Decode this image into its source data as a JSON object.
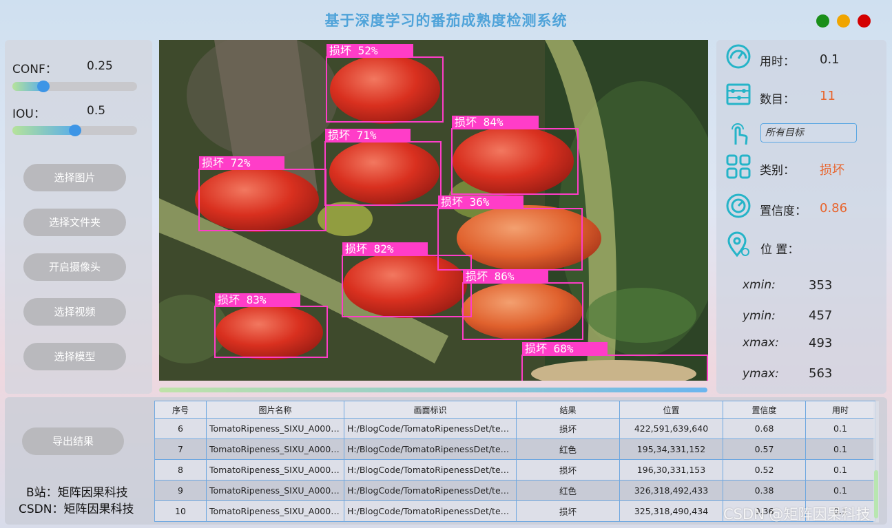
{
  "app": {
    "title": "基于深度学习的番茄成熟度检测系统"
  },
  "window_controls": [
    {
      "name": "maximize",
      "color": "#1a8f1a"
    },
    {
      "name": "minimize",
      "color": "#f0a500"
    },
    {
      "name": "close",
      "color": "#d40000"
    }
  ],
  "settings": {
    "conf": {
      "label": "CONF：",
      "value": "0.25",
      "fraction": 0.25
    },
    "iou": {
      "label": "IOU：",
      "value": "0.5",
      "fraction": 0.5
    }
  },
  "buttons": {
    "select_image": "选择图片",
    "select_folder": "选择文件夹",
    "open_camera": "开启摄像头",
    "select_video": "选择视频",
    "select_model": "选择模型",
    "export": "导出结果"
  },
  "detections": [
    {
      "label": "损坏 52%"
    },
    {
      "label": "损坏 71%"
    },
    {
      "label": "损坏 84%"
    },
    {
      "label": "损坏 72%"
    },
    {
      "label": "损坏 36%"
    },
    {
      "label": "损坏 82%"
    },
    {
      "label": "损坏 86%"
    },
    {
      "label": "损坏 83%"
    },
    {
      "label": "损坏 68%"
    }
  ],
  "info": {
    "time": {
      "label": "用时：",
      "value": "0.1"
    },
    "count": {
      "label": "数目：",
      "value": "11"
    },
    "target_select": "所有目标",
    "category": {
      "label": "类别：",
      "value": "损坏"
    },
    "confidence": {
      "label": "置信度：",
      "value": "0.86"
    },
    "position": {
      "label": "位 置："
    },
    "xmin": {
      "label": "xmin:",
      "value": "353"
    },
    "ymin": {
      "label": "ymin:",
      "value": "457"
    },
    "xmax": {
      "label": "xmax:",
      "value": "493"
    },
    "ymax": {
      "label": "ymax:",
      "value": "563"
    },
    "accent_color": "#e8642c"
  },
  "table": {
    "headers": [
      "序号",
      "图片名称",
      "画面标识",
      "结果",
      "位置",
      "置信度",
      "用时"
    ],
    "rows": [
      [
        "6",
        "TomatoRipeness_SIXU_A0001...",
        "H:/BlogCode/TomatoRipenessDet/tes...",
        "损坏",
        "422,591,639,640",
        "0.68",
        "0.1"
      ],
      [
        "7",
        "TomatoRipeness_SIXU_A0001...",
        "H:/BlogCode/TomatoRipenessDet/tes...",
        "红色",
        "195,34,331,152",
        "0.57",
        "0.1"
      ],
      [
        "8",
        "TomatoRipeness_SIXU_A0001...",
        "H:/BlogCode/TomatoRipenessDet/tes...",
        "损坏",
        "196,30,331,153",
        "0.52",
        "0.1"
      ],
      [
        "9",
        "TomatoRipeness_SIXU_A0001...",
        "H:/BlogCode/TomatoRipenessDet/tes...",
        "红色",
        "326,318,492,433",
        "0.38",
        "0.1"
      ],
      [
        "10",
        "TomatoRipeness_SIXU_A0001...",
        "H:/BlogCode/TomatoRipenessDet/tes...",
        "损坏",
        "325,318,490,434",
        "0.36",
        "0.1"
      ]
    ]
  },
  "credits": {
    "bilibili": "B站：矩阵因果科技",
    "csdn": "CSDN：矩阵因果科技"
  },
  "watermark": "CSDN @矩阵因果科技"
}
